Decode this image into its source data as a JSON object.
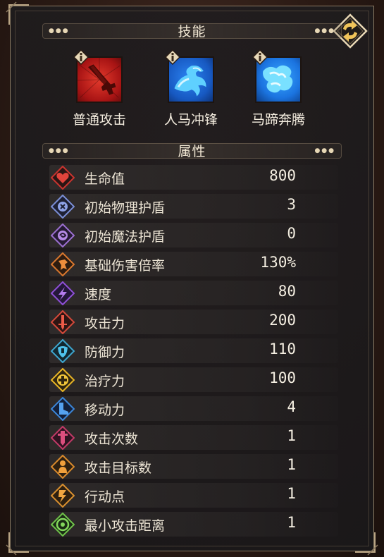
{
  "skills_section": {
    "title": "技能"
  },
  "skills": [
    {
      "name": "普通攻击",
      "icon": "sword-strike-icon",
      "color": "#c41c1c"
    },
    {
      "name": "人马冲锋",
      "icon": "centaur-charge-icon",
      "color": "#1f6fe0"
    },
    {
      "name": "马蹄奔腾",
      "icon": "hoof-stampede-icon",
      "color": "#1e7ef0"
    }
  ],
  "attributes_section": {
    "title": "属性"
  },
  "attributes": [
    {
      "label": "生命值",
      "value": "800",
      "icon": "heart-icon",
      "color": "#c9342f"
    },
    {
      "label": "初始物理护盾",
      "value": "3",
      "icon": "physical-shield-icon",
      "color": "#7b8fd6"
    },
    {
      "label": "初始魔法护盾",
      "value": "0",
      "icon": "magic-shield-icon",
      "color": "#9b6fd0"
    },
    {
      "label": "基础伤害倍率",
      "value": "130%",
      "icon": "damage-multiplier-icon",
      "color": "#d9772e"
    },
    {
      "label": "速度",
      "value": "80",
      "icon": "speed-icon",
      "color": "#8e4fd6"
    },
    {
      "label": "攻击力",
      "value": "200",
      "icon": "attack-icon",
      "color": "#d4493a"
    },
    {
      "label": "防御力",
      "value": "110",
      "icon": "defense-icon",
      "color": "#3ea6cf"
    },
    {
      "label": "治疗力",
      "value": "100",
      "icon": "heal-icon",
      "color": "#e8b525"
    },
    {
      "label": "移动力",
      "value": "4",
      "icon": "boot-icon",
      "color": "#3b86d8"
    },
    {
      "label": "攻击次数",
      "value": "1",
      "icon": "attack-count-icon",
      "color": "#c23a67"
    },
    {
      "label": "攻击目标数",
      "value": "1",
      "icon": "target-count-icon",
      "color": "#d98a2c"
    },
    {
      "label": "行动点",
      "value": "1",
      "icon": "action-point-icon",
      "color": "#d9902f"
    },
    {
      "label": "最小攻击距离",
      "value": "1",
      "icon": "range-icon",
      "color": "#6fc24a"
    }
  ]
}
